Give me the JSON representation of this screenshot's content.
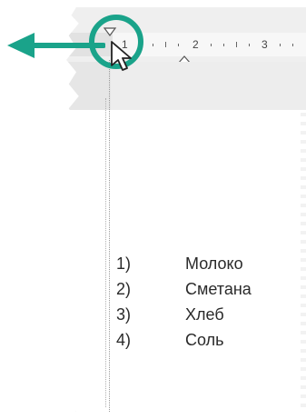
{
  "ruler": {
    "numbers": [
      "1",
      "2",
      "3"
    ],
    "units": "inches"
  },
  "list": {
    "items": [
      {
        "num": "1)",
        "text": "Молоко"
      },
      {
        "num": "2)",
        "text": "Сметана"
      },
      {
        "num": "3)",
        "text": "Хлеб"
      },
      {
        "num": "4)",
        "text": "Соль"
      }
    ]
  },
  "colors": {
    "accent": "#1aa38a",
    "ruler_bg": "#efefef",
    "text": "#2a2a2a"
  },
  "icons": [
    "left-arrow-icon",
    "first-line-indent-marker-icon",
    "hanging-indent-marker-icon",
    "mouse-pointer-icon",
    "highlight-ring-icon"
  ]
}
